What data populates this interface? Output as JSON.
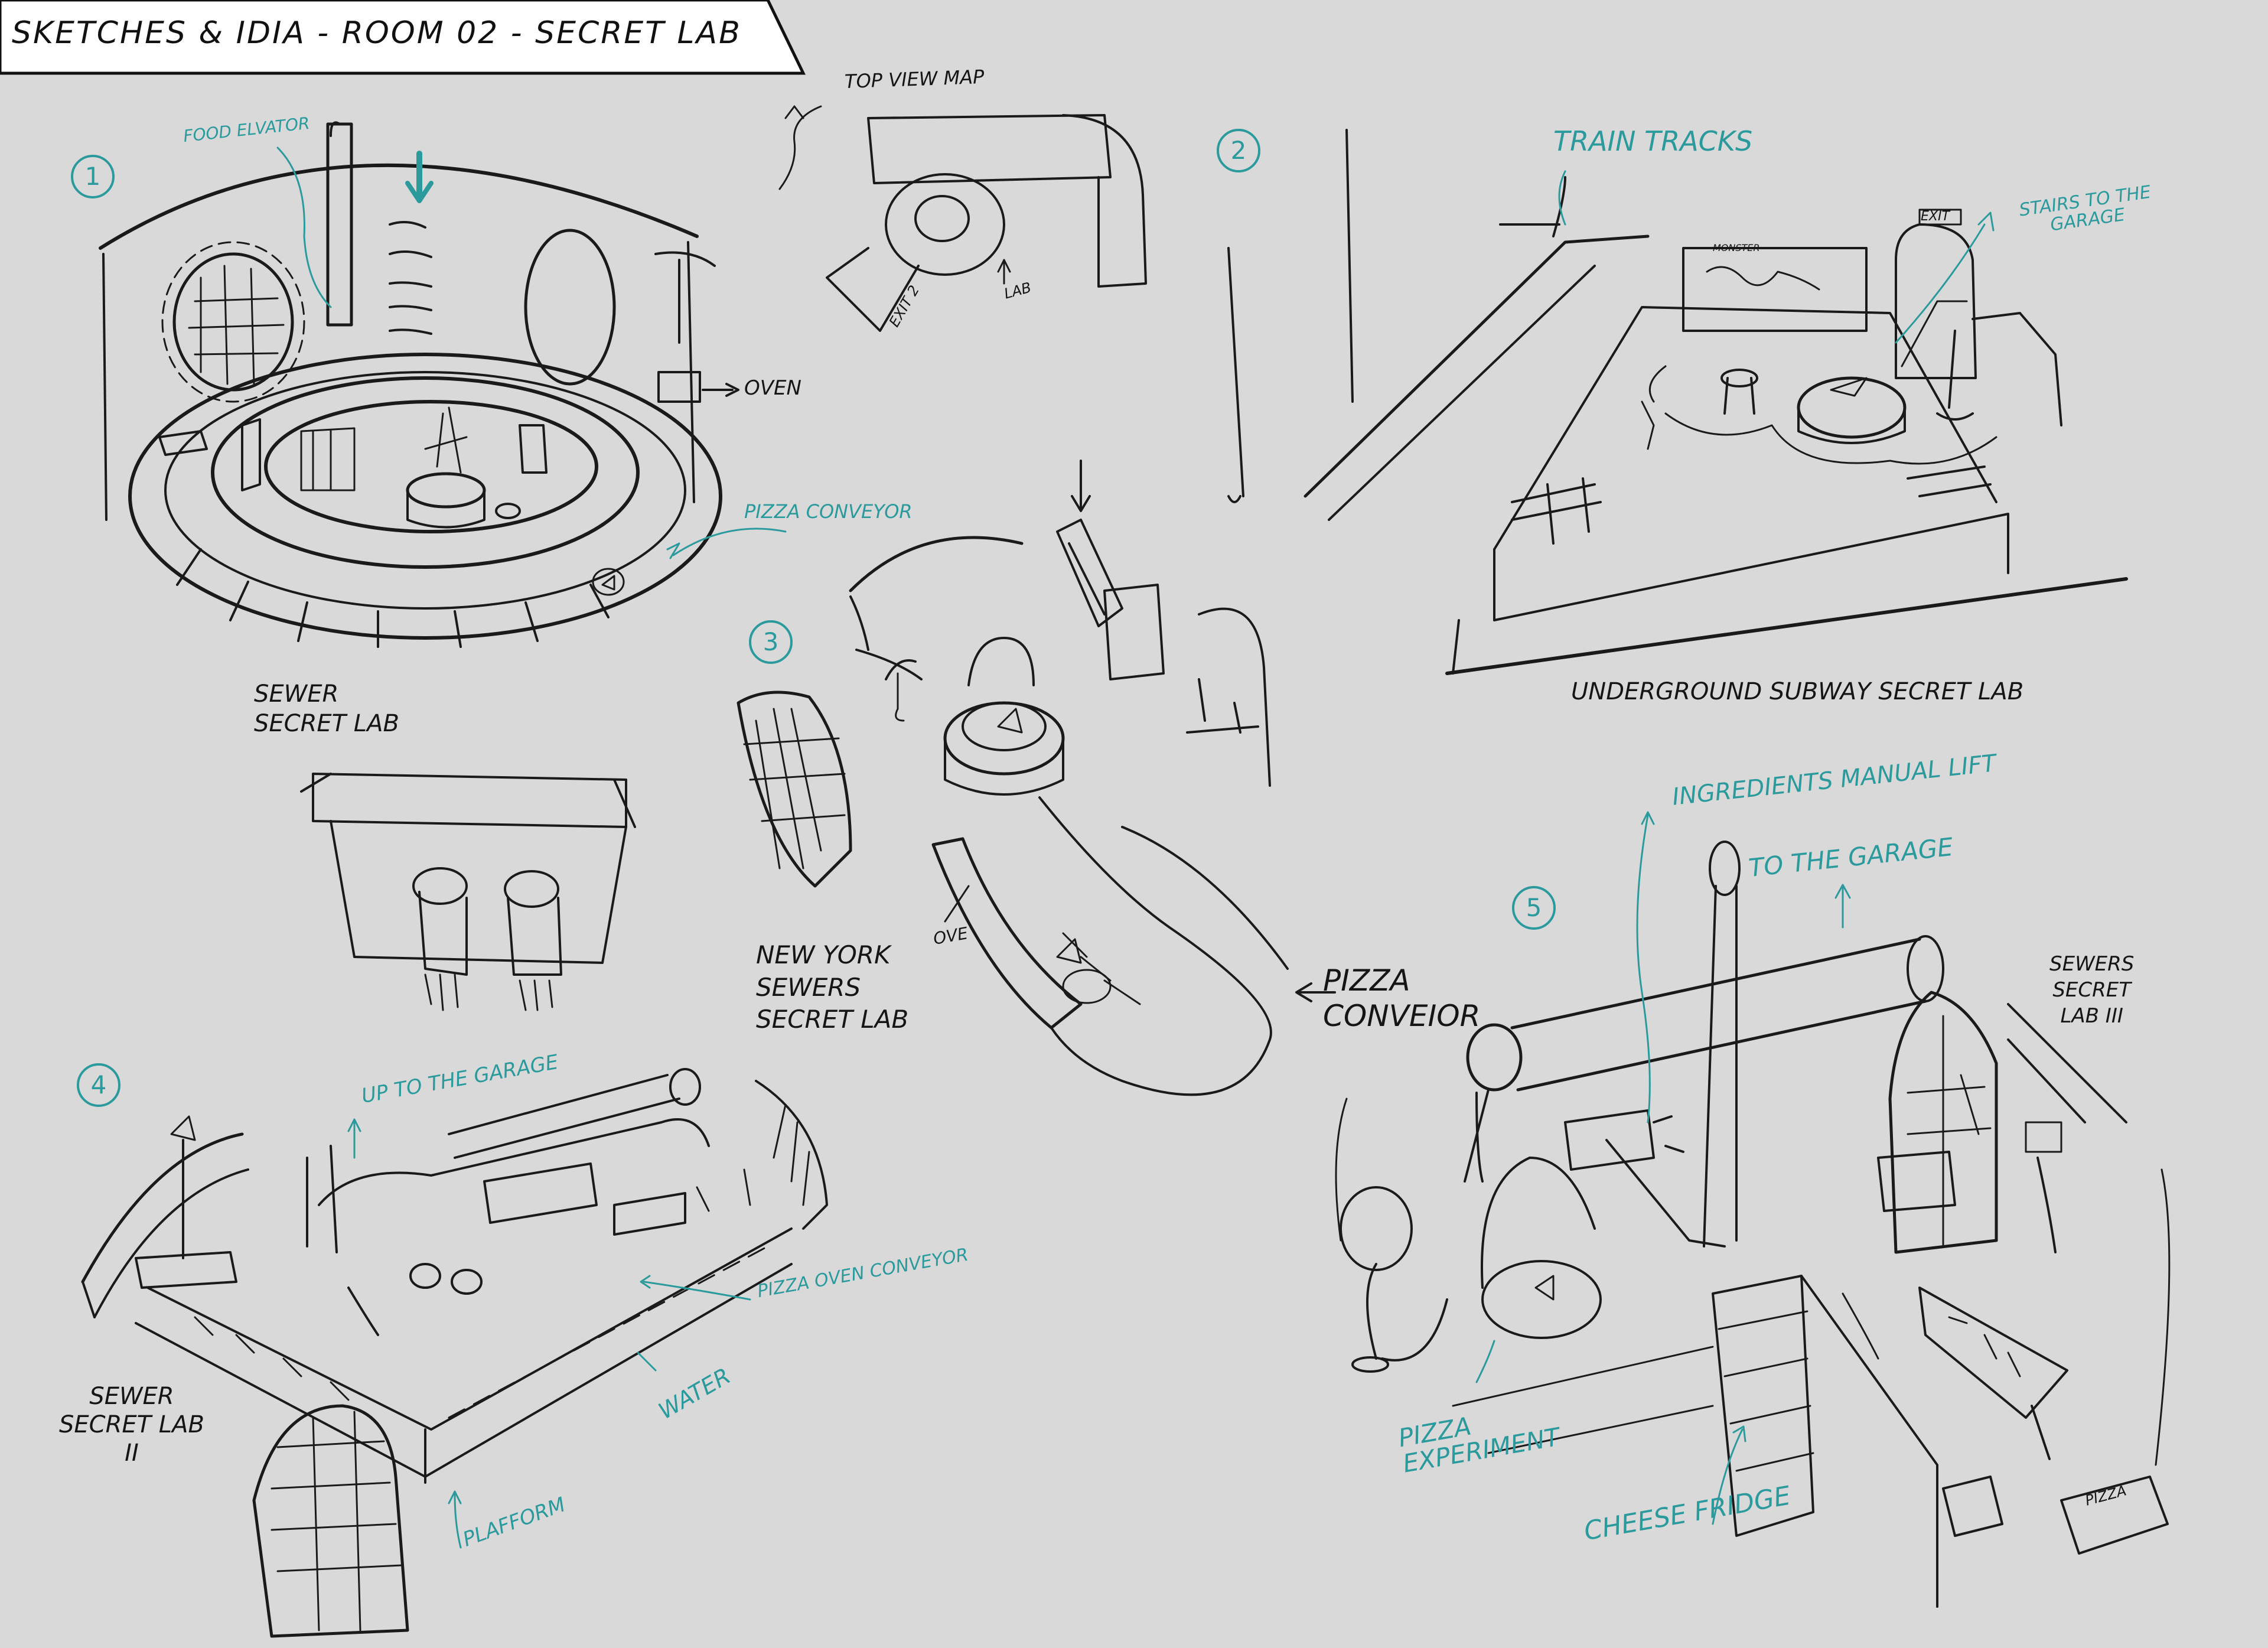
{
  "title": "SKETCHES & IDIA - ROOM 02 - SECRET LAB",
  "colors": {
    "background": "#d9d9d9",
    "ink": "#151515",
    "accent": "#2a9a9c"
  },
  "numbers": {
    "n1": "1",
    "n2": "2",
    "n3": "3",
    "n4": "4",
    "n5": "5"
  },
  "top_view": {
    "title": "TOP VIEW MAP",
    "exit": "EXIT 2",
    "lab": "LAB"
  },
  "sketch1": {
    "food_elevator": "FOOD ELVATOR",
    "oven": "OVEN",
    "pizza_conveyor": "PIZZA CONVEYOR",
    "caption": "SEWER\nSECRET LAB"
  },
  "sketch2": {
    "train_tracks": "TRAIN TRACKS",
    "exit_sign": "EXIT",
    "stairs": "STAIRS TO THE\nGARAGE",
    "monster_sign": "MONSTER",
    "caption": "UNDERGROUND SUBWAY SECRET LAB"
  },
  "sketch3": {
    "oven": "OVE",
    "pizza_conveior": "PIZZA\nCONVEIOR",
    "caption": "NEW YORK\nSEWERS\nSECRET LAB"
  },
  "sketch4": {
    "up_garage": "UP TO THE GARAGE",
    "pizza_oven_conveyor": "PIZZA OVEN CONVEYOR",
    "water": "WATER",
    "platform": "PLAFFORM",
    "caption": "SEWER\nSECRET LAB\nII"
  },
  "sketch5": {
    "ingredients_lift": "INGREDIENTS MANUAL LIFT",
    "to_garage": "TO THE GARAGE",
    "pizza_experiment": "PIZZA\nEXPERIMENT",
    "cheese_fridge": "CHEESE FRIDGE",
    "pizza_box": "PIZZA",
    "caption": "SEWERS\nSECRET\nLAB III"
  }
}
